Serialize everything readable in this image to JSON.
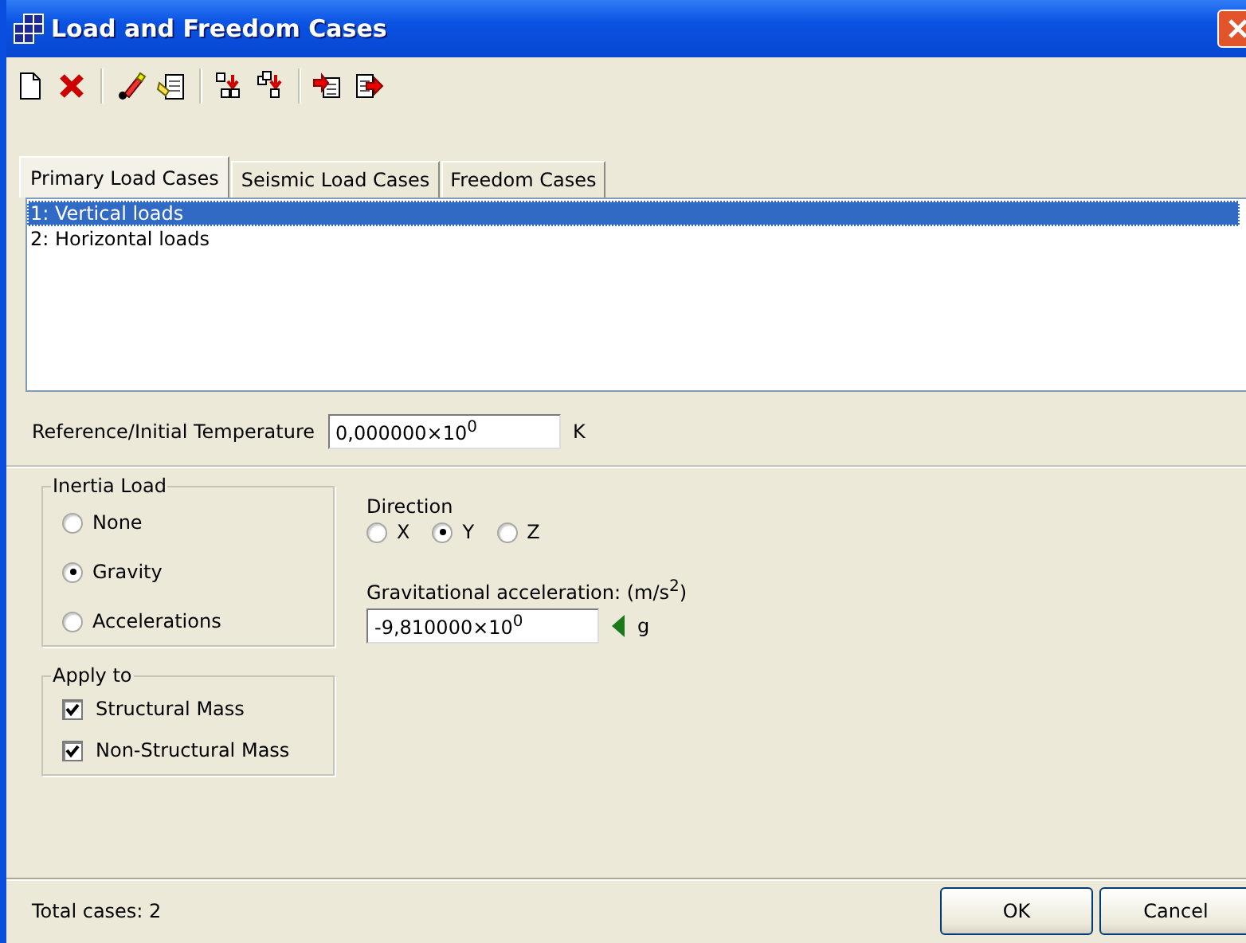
{
  "window": {
    "title": "Load and Freedom Cases"
  },
  "tabs": [
    {
      "label": "Primary Load Cases",
      "selected": true
    },
    {
      "label": "Seismic Load Cases",
      "selected": false
    },
    {
      "label": "Freedom Cases",
      "selected": false
    }
  ],
  "cases": [
    {
      "label": "1: Vertical loads",
      "selected": true
    },
    {
      "label": "2: Horizontal loads",
      "selected": false
    }
  ],
  "temperature": {
    "label": "Reference/Initial Temperature",
    "value": "0,000000×10$^{0}$",
    "unit": "K"
  },
  "inertia_load": {
    "title": "Inertia Load",
    "options": [
      {
        "label": "None",
        "selected": false
      },
      {
        "label": "Gravity",
        "selected": true
      },
      {
        "label": "Accelerations",
        "selected": false
      }
    ]
  },
  "direction": {
    "title": "Direction",
    "options": [
      {
        "label": "X",
        "selected": false
      },
      {
        "label": "Y",
        "selected": true
      },
      {
        "label": "Z",
        "selected": false
      }
    ]
  },
  "gravitational_acceleration": {
    "label": "Gravitational acceleration: (m/s$^{2}$)",
    "value": "-9,810000×10$^{0}$",
    "unit": "g"
  },
  "apply_to": {
    "title": "Apply to",
    "options": [
      {
        "label": "Structural Mass",
        "checked": true
      },
      {
        "label": "Non-Structural Mass",
        "checked": true
      }
    ]
  },
  "status": "Total cases: 2",
  "buttons": [
    "OK",
    "Cancel"
  ]
}
